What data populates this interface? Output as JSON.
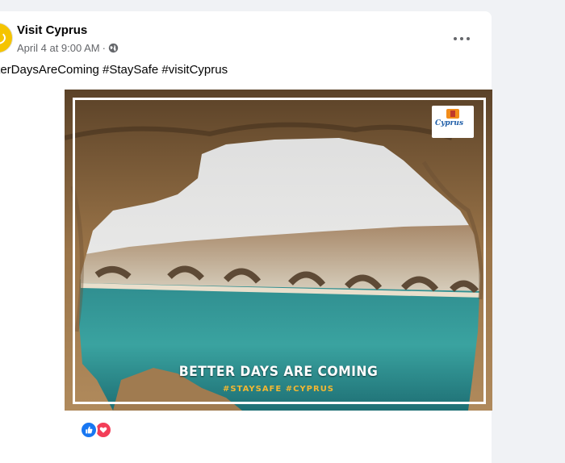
{
  "post": {
    "page_name": "Visit Cyprus",
    "timestamp": "April 4 at 9:00 AM",
    "separator": "·",
    "caption": "tterDaysAreComing #StaySafe #visitCyprus"
  },
  "image": {
    "headline": "BETTER DAYS ARE COMING",
    "hashtags": "#STAYSAFE #CYPRUS",
    "logo_text": "Cyprus"
  },
  "icons": {
    "privacy": "globe-icon",
    "more": "more-options-icon",
    "reactions": [
      "like-icon",
      "love-icon"
    ]
  },
  "colors": {
    "like": "#1877f2",
    "love": "#f33e58",
    "hashtag_accent": "#f2b732"
  }
}
